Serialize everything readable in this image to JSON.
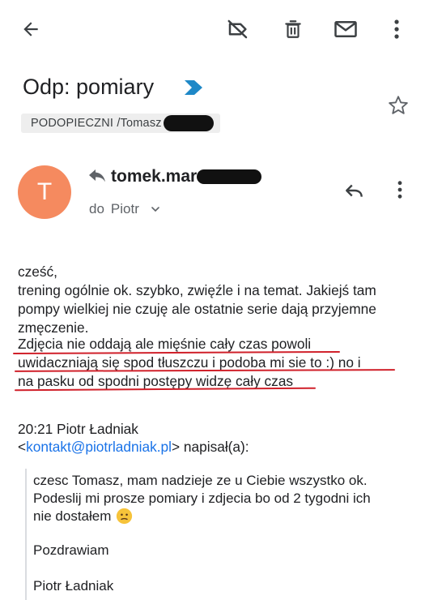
{
  "toolbar": {
    "back": "back-arrow-icon",
    "label": "label-off-icon",
    "delete": "trash-icon",
    "unread": "mail-icon",
    "more": "more-vert-icon"
  },
  "subject": "Odp: pomiary",
  "label_chip": "PODOPIECZNI /Tomasz",
  "sender": {
    "avatar_letter": "T",
    "avatar_color": "#f58a5f",
    "name": "tomek.mar",
    "recipient_prefix": "do",
    "recipient": "Piotr"
  },
  "body": {
    "lines": [
      "cześć,",
      "trening ogólnie ok. szybko, zwięźle i na temat. Jakiejś tam",
      "pompy wielkiej nie czuję ale ostatnie serie dają przyjemne",
      "zmęczenie.",
      "Zdjęcia nie oddają ale mięśnie cały czas powoli",
      "uwidaczniają się spod tłuszczu i podoba mi sie to :) no i",
      "na pasku od spodni postępy widzę cały czas"
    ]
  },
  "quoted_header": {
    "line1": "20:21 Piotr Ładniak",
    "email_open": "<",
    "email": "kontakt@piotrladniak.pl",
    "email_close": "> napisał(a):"
  },
  "quote": {
    "line1": "czesc Tomasz, mam nadzieje ze u Ciebie wszystko ok.",
    "line2": "Podeslij mi prosze pomiary i zdjecia bo od 2 tygodni ich",
    "line3": "nie dostałem",
    "greeting": "Pozdrawiam",
    "signature": "Piotr Ładniak"
  },
  "colors": {
    "underline": "#d0202a",
    "link": "#1a73e8",
    "importance": "#1e88c7"
  }
}
